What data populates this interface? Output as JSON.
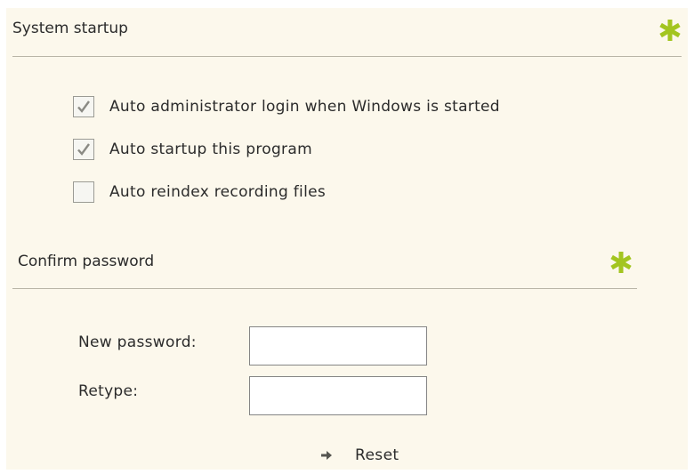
{
  "colors": {
    "panel_background": "#fcf8ec",
    "accent_asterisk": "#a3c520",
    "rule": "#b9b5a7",
    "text": "#2b2b2b"
  },
  "system_startup": {
    "title": "System startup",
    "required_icon": "asterisk-icon",
    "options": [
      {
        "label": "Auto administrator login when Windows is started",
        "checked": true
      },
      {
        "label": "Auto startup this program",
        "checked": true
      },
      {
        "label": "Auto reindex recording files",
        "checked": false
      }
    ]
  },
  "confirm_password": {
    "title": "Confirm password",
    "required_icon": "asterisk-icon",
    "new_password": {
      "label": "New password:",
      "value": ""
    },
    "retype": {
      "label": "Retype:",
      "value": ""
    }
  },
  "reset": {
    "label": "Reset",
    "icon": "arrow-right-icon"
  }
}
